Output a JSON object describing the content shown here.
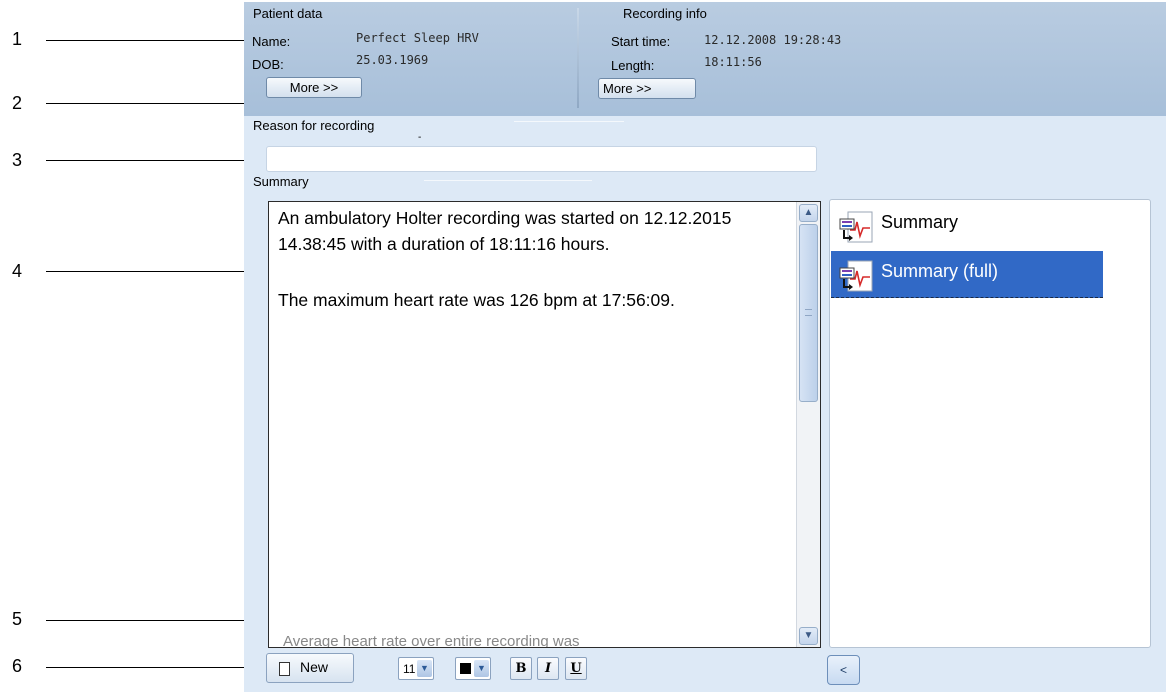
{
  "callouts": [
    "1",
    "2",
    "3",
    "4",
    "5",
    "6"
  ],
  "patient": {
    "title": "Patient data",
    "name_label": "Name:",
    "name_value": "Perfect Sleep HRV",
    "dob_label": "DOB:",
    "dob_value": "25.03.1969",
    "more_label": "More >>"
  },
  "recording": {
    "title": "Recording info",
    "start_label": "Start time:",
    "start_value": "12.12.2008 19:28:43",
    "length_label": "Length:",
    "length_value": "18:11:56",
    "more_label": "More >>"
  },
  "reason": {
    "label": "Reason for recording",
    "dash": "-",
    "value": ""
  },
  "summary": {
    "label": "Summary",
    "paragraph1": "An ambulatory Holter recording was started on 12.12.2015 14.38:45 with a duration of 18:11:16 hours.",
    "paragraph2": "The maximum heart rate was 126 bpm at 17:56:09.",
    "cut_off_text": "Average heart rate over entire recording was"
  },
  "templates": {
    "items": [
      {
        "label": "Summary",
        "selected": false
      },
      {
        "label": "Summary (full)",
        "selected": true
      }
    ],
    "icon": "report-template-icon"
  },
  "toolbar": {
    "new_label": "New",
    "font_size": "11",
    "bold": "B",
    "italic": "I",
    "underline": "U",
    "collapse_label": "<"
  },
  "colors": {
    "header": "#b0c6de",
    "background": "#dde9f6",
    "selection": "#3169c6"
  }
}
